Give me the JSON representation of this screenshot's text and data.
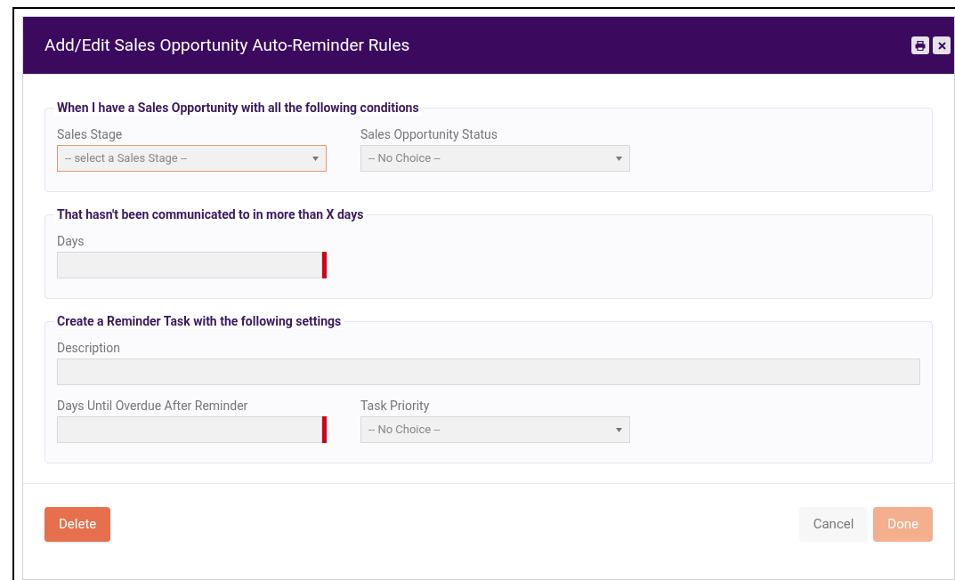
{
  "window": {
    "title": "Add/Edit Sales Opportunity Auto-Reminder Rules",
    "buttons": [
      {
        "kind": "print"
      },
      {
        "kind": "close"
      }
    ]
  },
  "sections": [
    {
      "title": "When I have a Sales Opportunity with all the following conditions",
      "rows": [
        [
          {
            "label": "Sales Stage",
            "kind": "select",
            "value": "-- select a Sales Stage --",
            "focused": true,
            "required": false
          },
          {
            "label": "Sales Opportunity Status",
            "kind": "select",
            "value": "-- No Choice --",
            "focused": false,
            "required": false
          }
        ]
      ]
    },
    {
      "title": "That hasn't been communicated to in more than X days",
      "rows": [
        [
          {
            "label": "Days",
            "kind": "text",
            "focused": false,
            "required": true
          }
        ]
      ]
    },
    {
      "title": "Create a Reminder Task with the following settings",
      "rows": [
        [
          {
            "label": "Description",
            "kind": "wide_text",
            "focused": false,
            "required": false
          }
        ],
        [
          {
            "label": "Days Until Overdue After Reminder",
            "kind": "text",
            "focused": false,
            "required": true
          },
          {
            "label": "Task Priority",
            "kind": "select",
            "value": "-- No Choice --",
            "focused": false,
            "required": false
          }
        ]
      ]
    }
  ],
  "footer": {
    "left": [
      {
        "label": "Delete",
        "kind": "danger",
        "disabled": false
      }
    ],
    "right": [
      {
        "label": "Cancel",
        "kind": "plain",
        "disabled": false
      },
      {
        "label": "Done",
        "kind": "primary",
        "disabled": true
      }
    ]
  }
}
